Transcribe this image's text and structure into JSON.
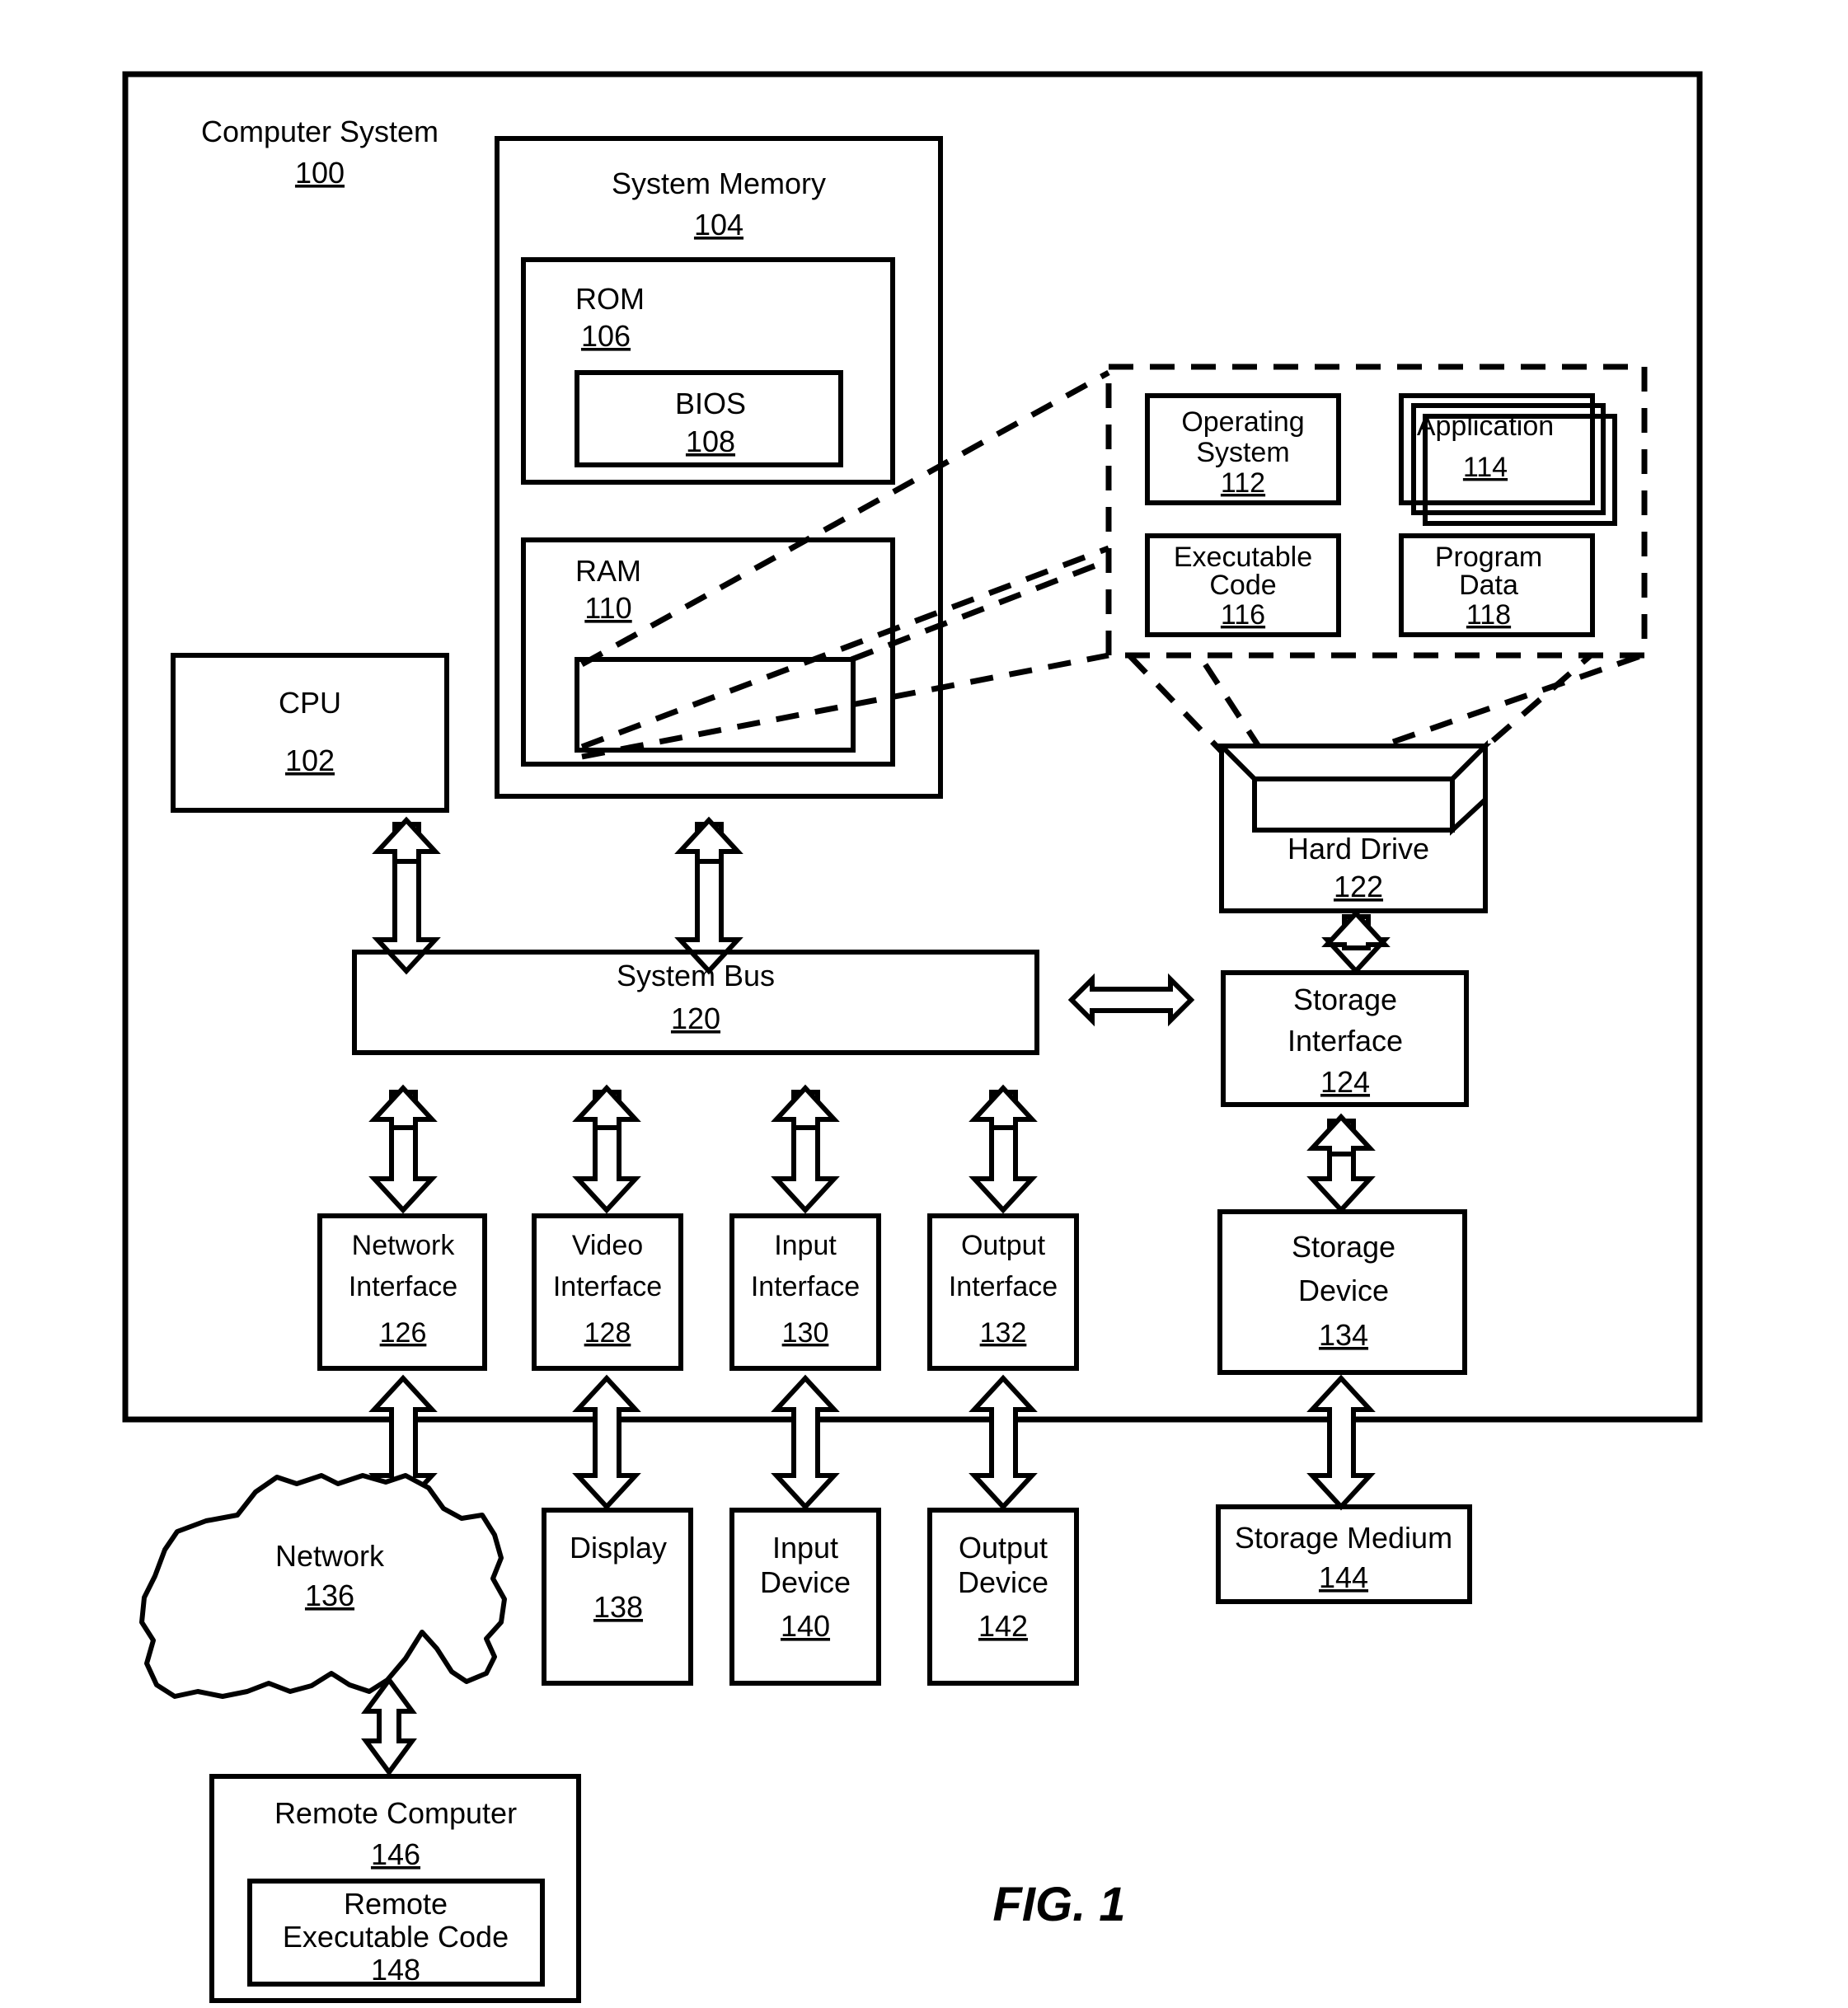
{
  "figure": {
    "caption": "FIG. 1",
    "title": "Computer System Block Diagram"
  },
  "outer": {
    "label": "Computer System",
    "ref": "100"
  },
  "system_memory": {
    "label": "System Memory",
    "ref": "104",
    "rom": {
      "label": "ROM",
      "ref": "106",
      "bios": {
        "label": "BIOS",
        "ref": "108"
      }
    },
    "ram": {
      "label": "RAM",
      "ref": "110"
    }
  },
  "cpu": {
    "label": "CPU",
    "ref": "102"
  },
  "callout": {
    "items": [
      {
        "label_line1": "Operating",
        "label_line2": "System",
        "ref": "112",
        "name": "operating-system"
      },
      {
        "label_line1": "Application",
        "label_line2": "",
        "ref": "114",
        "name": "application"
      },
      {
        "label_line1": "Executable",
        "label_line2": "Code",
        "ref": "116",
        "name": "executable-code"
      },
      {
        "label_line1": "Program",
        "label_line2": "Data",
        "ref": "118",
        "name": "program-data"
      }
    ]
  },
  "hard_drive": {
    "label": "Hard Drive",
    "ref": "122"
  },
  "system_bus": {
    "label": "System Bus",
    "ref": "120"
  },
  "storage_interface": {
    "label_line1": "Storage",
    "label_line2": "Interface",
    "ref": "124"
  },
  "interfaces": [
    {
      "label_line1": "Network",
      "label_line2": "Interface",
      "ref": "126",
      "name": "network-interface"
    },
    {
      "label_line1": "Video",
      "label_line2": "Interface",
      "ref": "128",
      "name": "video-interface"
    },
    {
      "label_line1": "Input",
      "label_line2": "Interface",
      "ref": "130",
      "name": "input-interface"
    },
    {
      "label_line1": "Output",
      "label_line2": "Interface",
      "ref": "132",
      "name": "output-interface"
    }
  ],
  "storage_device": {
    "label_line1": "Storage",
    "label_line2": "Device",
    "ref": "134"
  },
  "peripherals": [
    {
      "label_line1": "Network",
      "label_line2": "",
      "ref": "136",
      "name": "network-cloud"
    },
    {
      "label_line1": "Display",
      "label_line2": "",
      "ref": "138",
      "name": "display"
    },
    {
      "label_line1": "Input",
      "label_line2": "Device",
      "ref": "140",
      "name": "input-device"
    },
    {
      "label_line1": "Output",
      "label_line2": "Device",
      "ref": "142",
      "name": "output-device"
    }
  ],
  "storage_medium": {
    "label": "Storage Medium",
    "ref": "144"
  },
  "remote_computer": {
    "label": "Remote Computer",
    "ref": "146",
    "code": {
      "label_line1": "Remote",
      "label_line2": "Executable Code",
      "ref": "148"
    }
  },
  "colors": {
    "stroke": "#000000",
    "background": "#ffffff"
  }
}
